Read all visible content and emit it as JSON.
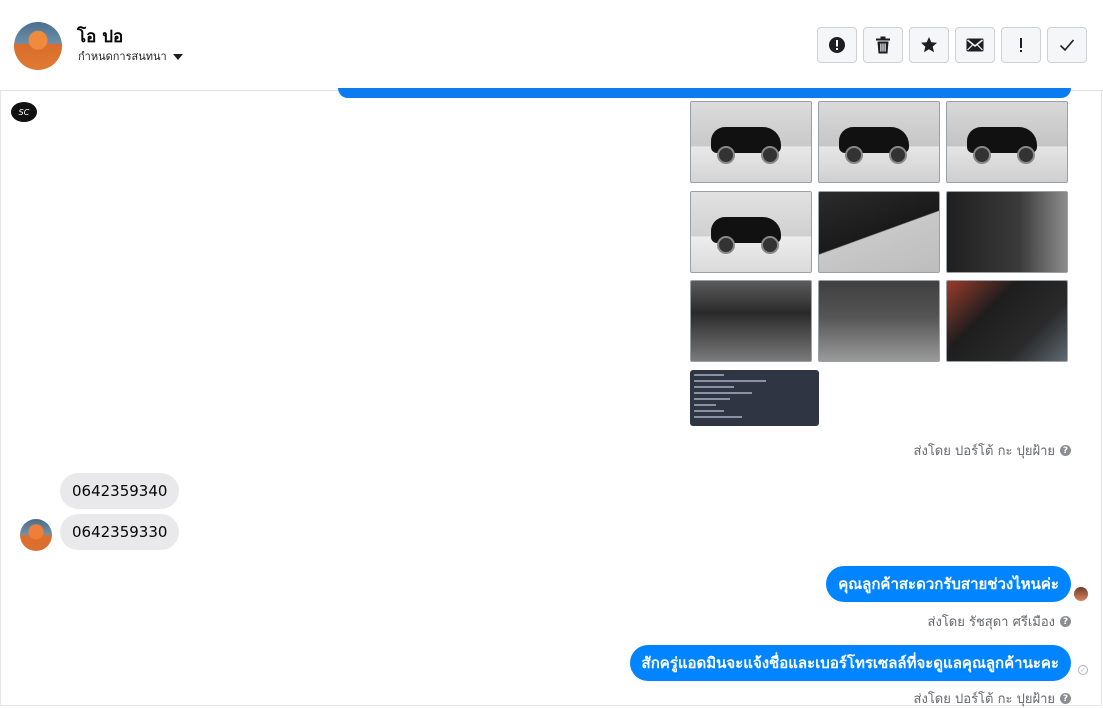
{
  "header": {
    "contact_name": "โอ ปอ",
    "conversation_menu_label": "กำหนดการสนทนา",
    "actions": [
      {
        "name": "report-button",
        "icon": "alert-circle-icon"
      },
      {
        "name": "delete-button",
        "icon": "trash-icon"
      },
      {
        "name": "star-button",
        "icon": "star-icon"
      },
      {
        "name": "mark-unread-button",
        "icon": "envelope-icon"
      },
      {
        "name": "important-button",
        "icon": "exclamation-icon"
      },
      {
        "name": "mark-done-button",
        "icon": "check-icon"
      }
    ]
  },
  "page_avatar_text": "SC",
  "photo_count": 10,
  "messages": [
    {
      "type": "sent_by_note",
      "text": "ส่งโดย ปอร์โต้ กะ ปุยฝ้าย"
    },
    {
      "type": "incoming",
      "text": "0642359340"
    },
    {
      "type": "incoming",
      "text": "0642359330"
    },
    {
      "type": "outgoing",
      "text": "คุณลูกค้าสะดวกรับสายช่วงไหนค่ะ"
    },
    {
      "type": "sent_by_note",
      "text": "ส่งโดย รัชสุดา ศรีเมือง"
    },
    {
      "type": "outgoing",
      "text": "สักครู่แอดมินจะแจ้งชื่อและเบอร์โทรเซลล์ที่จะดูแลคุณลูกค้านะคะ"
    },
    {
      "type": "sent_by_note",
      "text": "ส่งโดย ปอร์โต้ กะ ปุยฝ้าย"
    }
  ],
  "colors": {
    "outgoing_bubble": "#0084ff",
    "incoming_bubble": "#e9e9eb",
    "accent_line": "#0b7bf2"
  }
}
